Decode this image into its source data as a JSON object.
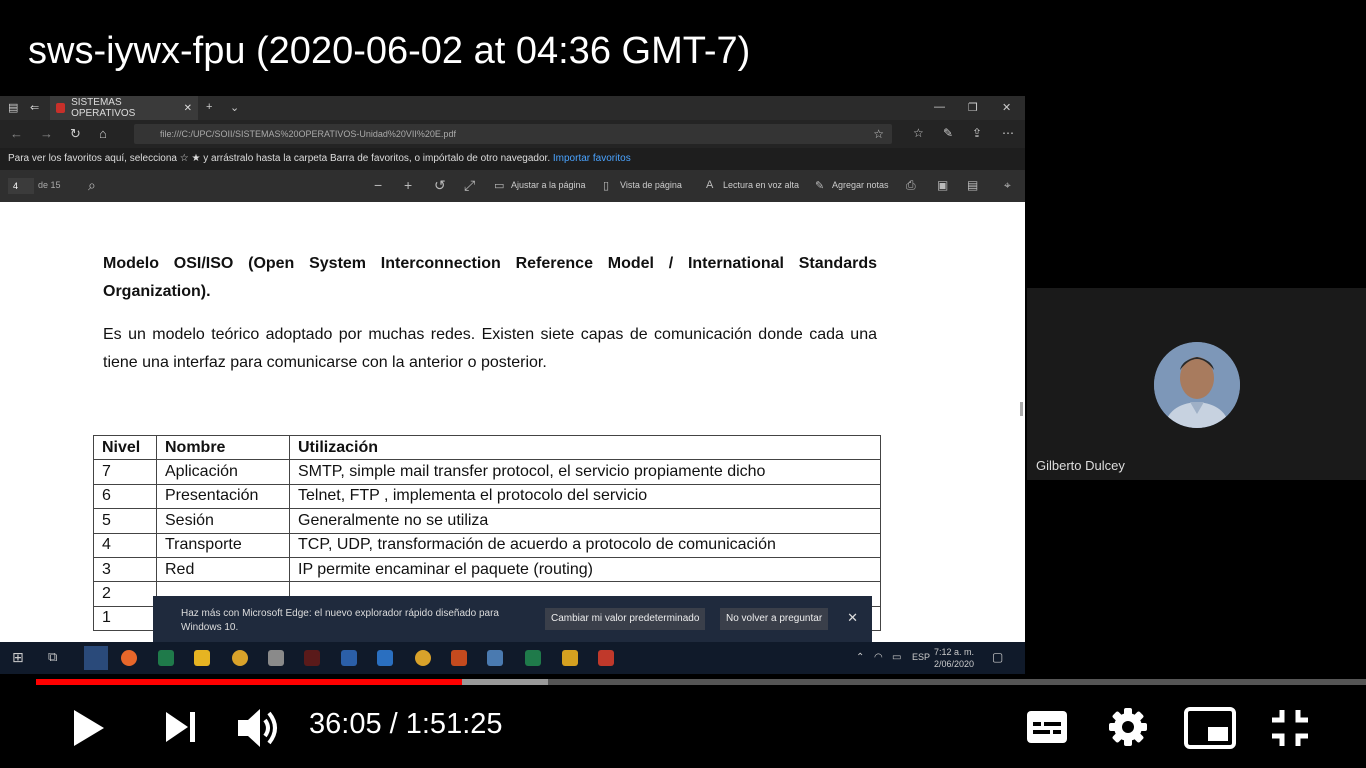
{
  "video": {
    "title": "sws-iywx-fpu (2020-06-02 at 04:36 GMT-7)",
    "current_time": "36:05",
    "separator": " / ",
    "duration": "1:51:25",
    "progress_fraction": 0.32,
    "buffered_fraction": 0.385
  },
  "browser": {
    "tab_title": "SISTEMAS OPERATIVOS",
    "url": "file:///C:/UPC/SOII/SISTEMAS%20OPERATIVOS-Unidad%20VII%20E.pdf",
    "favorites_text": "Para ver los favoritos aquí, selecciona ☆ ★ y arrástralo hasta la carpeta Barra de favoritos, o impórtalo de otro navegador.",
    "favorites_link": "Importar favoritos"
  },
  "pdf_toolbar": {
    "page": "4",
    "of_pages": "de 15",
    "fit_page": "Ajustar a la página",
    "page_view": "Vista de página",
    "read_aloud": "Lectura en voz alta",
    "add_notes": "Agregar notas"
  },
  "document": {
    "heading": "Modelo OSI/ISO (Open System Interconnection Reference Model /  International Standards Organization).",
    "paragraph": "Es un modelo teórico adoptado por muchas redes. Existen siete  capas de comunicación donde cada una tiene una interfaz para comunicarse con la anterior o posterior.",
    "table": {
      "headers": [
        "Nivel",
        "Nombre",
        "Utilización"
      ],
      "rows": [
        [
          "7",
          "Aplicación",
          "SMTP, simple mail transfer protocol, el servicio propiamente dicho"
        ],
        [
          "6",
          "Presentación",
          "Telnet, FTP , implementa el protocolo del servicio"
        ],
        [
          "5",
          "Sesión",
          "Generalmente no se utiliza"
        ],
        [
          "4",
          "Transporte",
          "TCP, UDP, transformación de acuerdo a protocolo de comunicación"
        ],
        [
          "3",
          "Red",
          "IP permite encaminar el paquete (routing)"
        ],
        [
          "2",
          "",
          ""
        ],
        [
          "1",
          "",
          ""
        ]
      ]
    }
  },
  "notification": {
    "message": "Haz más con Microsoft Edge: el nuevo explorador rápido diseñado para Windows 10.",
    "primary_button": "Cambiar mi valor predeterminado",
    "secondary_button": "No volver a preguntar",
    "close": "✕"
  },
  "taskbar": {
    "language": "ESP",
    "time": "7:12 a. m.",
    "date": "2/06/2020"
  },
  "participant": {
    "name": "Gilberto Dulcey"
  },
  "icons": [
    "play-icon",
    "next-icon",
    "volume-icon",
    "subtitles-icon",
    "settings-gear-icon",
    "miniplayer-icon",
    "exit-fullscreen-icon"
  ],
  "colors": {
    "progress_played": "#ff0000",
    "progress_buffered": "#999999",
    "background": "#000000"
  }
}
